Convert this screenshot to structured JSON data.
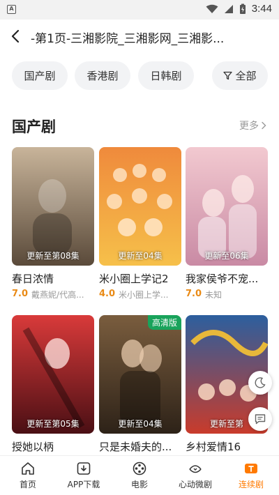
{
  "status_bar": {
    "time": "3:44",
    "app_letter": "A"
  },
  "header": {
    "title": "-第1页-三湘影院_三湘影网_三湘影..."
  },
  "filters": [
    {
      "label": "国产剧"
    },
    {
      "label": "香港剧"
    },
    {
      "label": "日韩剧"
    },
    {
      "label": "全部",
      "icon": "filter-icon"
    }
  ],
  "section": {
    "title": "国产剧",
    "more_label": "更多"
  },
  "cards": [
    {
      "title": "春日浓情",
      "score": "7.0",
      "cast": "戴燕妮/代高...",
      "episode": "更新至第08集",
      "hd": "",
      "colors": [
        "#c8b49a",
        "#5a4a3a"
      ]
    },
    {
      "title": "米小圈上学记2",
      "score": "4.0",
      "cast": "米小圈上学...",
      "episode": "更新至04集",
      "hd": "",
      "colors": [
        "#ef8a3c",
        "#f6c04a"
      ]
    },
    {
      "title": "我家侯爷不宠...",
      "score": "7.0",
      "cast": "未知",
      "episode": "更新至06集",
      "hd": "",
      "colors": [
        "#f2c9d0",
        "#c98aa4"
      ]
    },
    {
      "title": "授她以柄",
      "score": "",
      "cast": "",
      "episode": "更新至第05集",
      "hd": "",
      "colors": [
        "#d93a3a",
        "#4a0f14"
      ]
    },
    {
      "title": "只是未婚夫的...",
      "score": "",
      "cast": "",
      "episode": "更新至04集",
      "hd": "高清版",
      "colors": [
        "#7a5d3e",
        "#2d2218"
      ]
    },
    {
      "title": "乡村爱情16",
      "score": "",
      "cast": "",
      "episode": "更新至第",
      "hd": "",
      "colors": [
        "#2c5f9e",
        "#c93b2b"
      ]
    }
  ],
  "bottom_nav": [
    {
      "label": "首页",
      "icon": "home-icon"
    },
    {
      "label": "APP下载",
      "icon": "app-download-icon"
    },
    {
      "label": "电影",
      "icon": "film-reel-icon"
    },
    {
      "label": "心动微剧",
      "icon": "heart-drama-icon"
    },
    {
      "label": "连续剧",
      "icon": "tv-icon",
      "active": true
    }
  ],
  "colors": {
    "accent": "#ff7a00",
    "score": "#e98a15",
    "hd_badge": "#19a35b"
  }
}
